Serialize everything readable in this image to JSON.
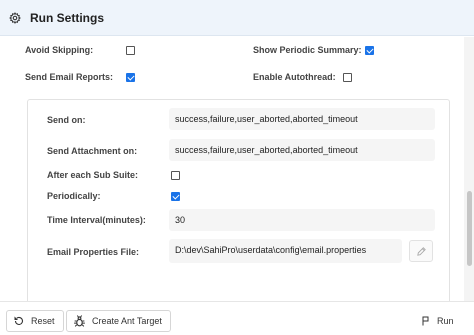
{
  "window": {
    "title": "Run Settings"
  },
  "top_options": {
    "avoid_skipping": {
      "label": "Avoid Skipping:",
      "checked": false
    },
    "show_periodic_summary": {
      "label": "Show Periodic Summary:",
      "checked": true
    },
    "send_email_reports": {
      "label": "Send Email Reports:",
      "checked": true
    },
    "enable_autothread": {
      "label": "Enable Autothread:",
      "checked": false
    }
  },
  "email_panel": {
    "send_on": {
      "label": "Send on:",
      "value": "success,failure,user_aborted,aborted_timeout"
    },
    "send_attachment_on": {
      "label": "Send Attachment on:",
      "value": "success,failure,user_aborted,aborted_timeout"
    },
    "after_each_sub_suite": {
      "label": "After each Sub Suite:",
      "checked": false
    },
    "periodically": {
      "label": "Periodically:",
      "checked": true
    },
    "time_interval": {
      "label": "Time Interval(minutes):",
      "value": "30"
    },
    "email_properties_file": {
      "label": "Email Properties File:",
      "value": "D:\\dev\\SahiPro\\userdata\\config\\email.properties"
    }
  },
  "footer": {
    "reset_label": "Reset",
    "create_ant_target_label": "Create Ant Target",
    "run_label": "Run"
  },
  "colors": {
    "accent": "#1a73e8",
    "titlebar_bg": "#eef4fb"
  }
}
